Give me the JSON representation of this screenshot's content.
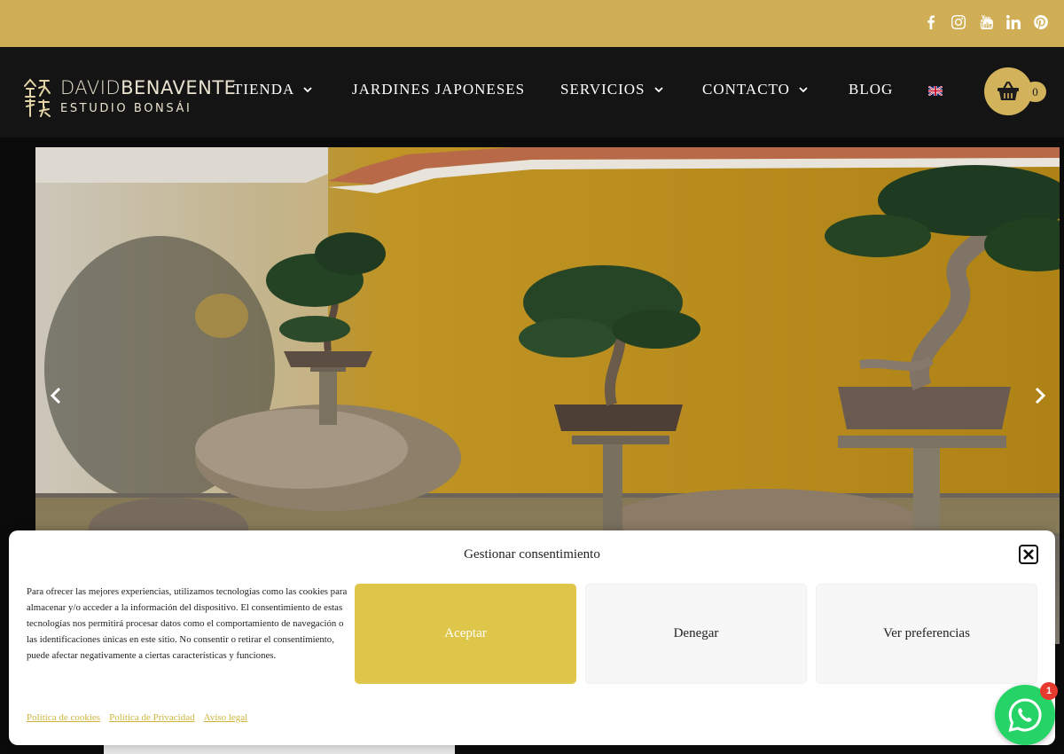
{
  "topbar": {
    "background": "#cfae55",
    "social_icons": [
      "facebook-icon",
      "instagram-icon",
      "youtube-icon",
      "linkedin-icon",
      "pinterest-icon"
    ]
  },
  "header": {
    "logo": {
      "line1_a": "DAVID",
      "line1_b": "BENAVENTE",
      "line2": "ESTUDIO BONSÁI"
    },
    "nav": [
      {
        "label": "TIENDA",
        "has_dropdown": true
      },
      {
        "label": "JARDINES JAPONESES",
        "has_dropdown": false
      },
      {
        "label": "SERVICIOS",
        "has_dropdown": true
      },
      {
        "label": "CONTACTO",
        "has_dropdown": true
      },
      {
        "label": "BLOG",
        "has_dropdown": false
      }
    ],
    "language_icon": "uk-flag-icon",
    "cart": {
      "icon": "basket-icon",
      "count": "0"
    }
  },
  "hero": {
    "image_subject": "bonsai-trees-yellow-wall",
    "prev_icon": "chevron-left-icon",
    "next_icon": "chevron-right-icon"
  },
  "cookie": {
    "title": "Gestionar consentimiento",
    "text": "Para ofrecer las mejores experiencias, utilizamos tecnologías como las cookies para almacenar y/o acceder a la información del dispositivo. El consentimiento de estas tecnologías nos permitirá procesar datos como el comportamiento de navegación o las identificaciones únicas en este sitio. No consentir o retirar el consentimiento, puede afectar negativamente a ciertas características y funciones.",
    "accept": "Aceptar",
    "deny": "Denegar",
    "preferences": "Ver preferencias",
    "links": [
      "Política de cookies",
      "Política de Privacidad",
      "Aviso legal"
    ],
    "accent": "#dec64b"
  },
  "whatsapp": {
    "badge": "1",
    "color": "#25d366"
  }
}
